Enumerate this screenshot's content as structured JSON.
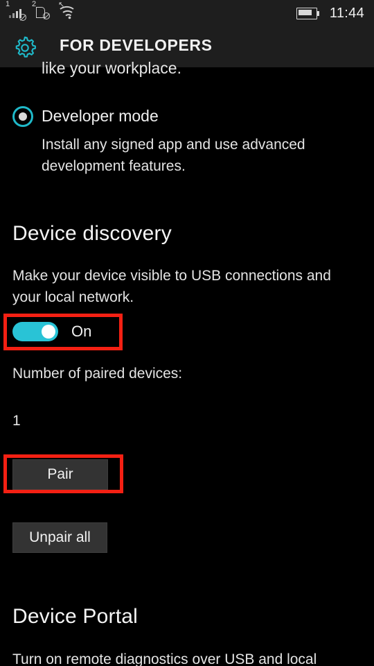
{
  "statusbar": {
    "sim1_superscript": "1",
    "sim2_superscript": "2",
    "time": "11:44",
    "signal_icon": "cellular-signal-no-service-icon",
    "sim_icon": "sim-card-no-service-icon",
    "wifi_icon": "wifi-icon",
    "battery_icon": "battery-icon"
  },
  "header": {
    "icon": "gear-icon",
    "title": "FOR DEVELOPERS"
  },
  "content": {
    "clipped_top_text": "like your workplace.",
    "developer_mode": {
      "label": "Developer mode",
      "selected": true,
      "description": "Install any signed app and use advanced development features."
    },
    "device_discovery": {
      "title": "Device discovery",
      "description": "Make your device visible to USB connections and your local network.",
      "toggle_state_label": "On",
      "toggle_on": true,
      "paired_devices_label": "Number of paired devices:",
      "paired_devices_count": "1",
      "pair_button": "Pair",
      "unpair_button": "Unpair all"
    },
    "device_portal": {
      "title": "Device Portal",
      "description": "Turn on remote diagnostics over USB and local"
    }
  },
  "colors": {
    "accent_teal": "#29c3d6",
    "annotation_red": "#f42013",
    "header_bg": "#1e1e1e",
    "page_bg": "#000000",
    "button_bg": "#333333"
  }
}
